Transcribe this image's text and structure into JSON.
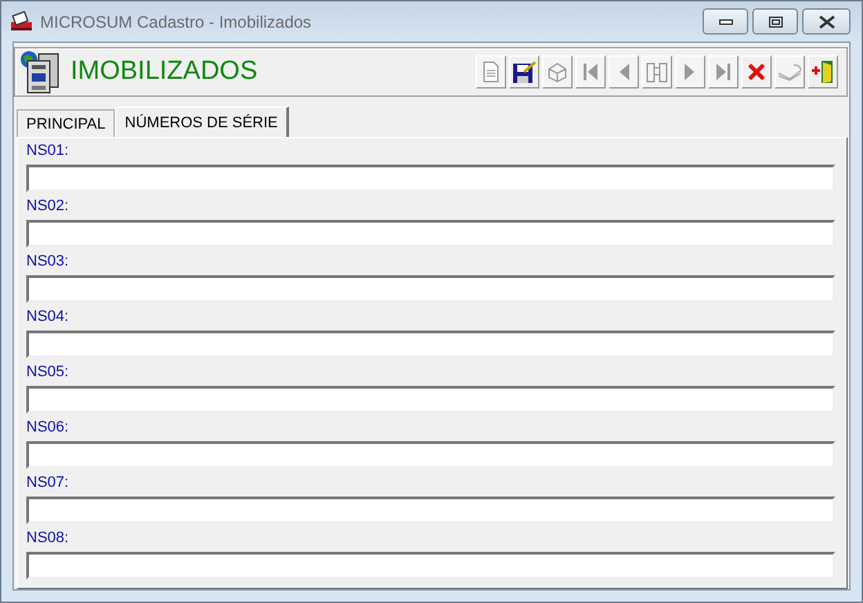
{
  "window": {
    "title": "MICROSUM Cadastro - Imobilizados"
  },
  "header": {
    "title": "IMOBILIZADOS"
  },
  "toolbar": [
    {
      "kind": "new",
      "disabled": true
    },
    {
      "kind": "save",
      "disabled": false
    },
    {
      "kind": "cancel",
      "disabled": true
    },
    {
      "kind": "first",
      "disabled": true
    },
    {
      "kind": "prev",
      "disabled": true
    },
    {
      "kind": "find",
      "disabled": true
    },
    {
      "kind": "next",
      "disabled": true
    },
    {
      "kind": "last",
      "disabled": true
    },
    {
      "kind": "delete",
      "disabled": false
    },
    {
      "kind": "print",
      "disabled": true
    },
    {
      "kind": "exit",
      "disabled": false
    }
  ],
  "tabs": [
    {
      "label": "PRINCIPAL",
      "selected": false
    },
    {
      "label": "NÚMEROS DE SÉRIE",
      "selected": true
    }
  ],
  "fields": [
    {
      "label": "NS01:"
    },
    {
      "label": "NS02:"
    },
    {
      "label": "NS03:"
    },
    {
      "label": "NS04:"
    },
    {
      "label": "NS05:"
    },
    {
      "label": "NS06:"
    },
    {
      "label": "NS07:"
    },
    {
      "label": "NS08:"
    }
  ]
}
